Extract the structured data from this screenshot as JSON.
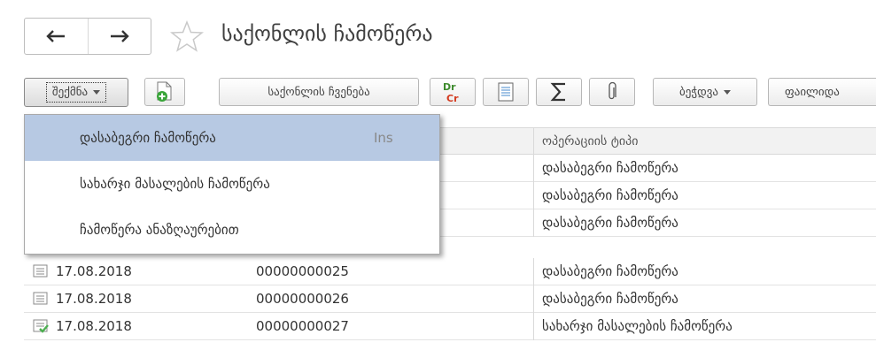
{
  "header": {
    "title": "საქონლის ჩამოწერა"
  },
  "toolbar": {
    "create_label": "შექმნა",
    "show_goods_label": "საქონლის ჩვენება",
    "print_label": "ბეჭდვა",
    "files_label": "ფაილიდა"
  },
  "dropdown": {
    "items": [
      {
        "label": "დასაბეგრი ჩამოწერა",
        "shortcut": "Ins"
      },
      {
        "label": "სახარჯი მასალების ჩამოწერა",
        "shortcut": ""
      },
      {
        "label": "ჩამოწერა ანაზღაურებით",
        "shortcut": ""
      }
    ]
  },
  "table": {
    "columns": {
      "type": "ოპერაციის ტიპი"
    },
    "rows": [
      {
        "date": "",
        "number": "",
        "type": "დასაბეგრი ჩამოწერა"
      },
      {
        "date": "",
        "number": "",
        "type": "დასაბეგრი ჩამოწერა"
      },
      {
        "date": "",
        "number": "",
        "type": "დასაბეგრი ჩამოწერა"
      },
      {
        "date": "17.08.2018",
        "number": "00000000025",
        "type": "დასაბეგრი ჩამოწერა"
      },
      {
        "date": "17.08.2018",
        "number": "00000000026",
        "type": "დასაბეგრი ჩამოწერა"
      },
      {
        "date": "17.08.2018",
        "number": "00000000027",
        "type": "სახარჯი მასალების ჩამოწერა"
      }
    ]
  },
  "colors": {
    "selection": "#b7c9e3",
    "green": "#4caf50",
    "dr_green": "#3d8a2c",
    "cr_red": "#d33a1f"
  }
}
